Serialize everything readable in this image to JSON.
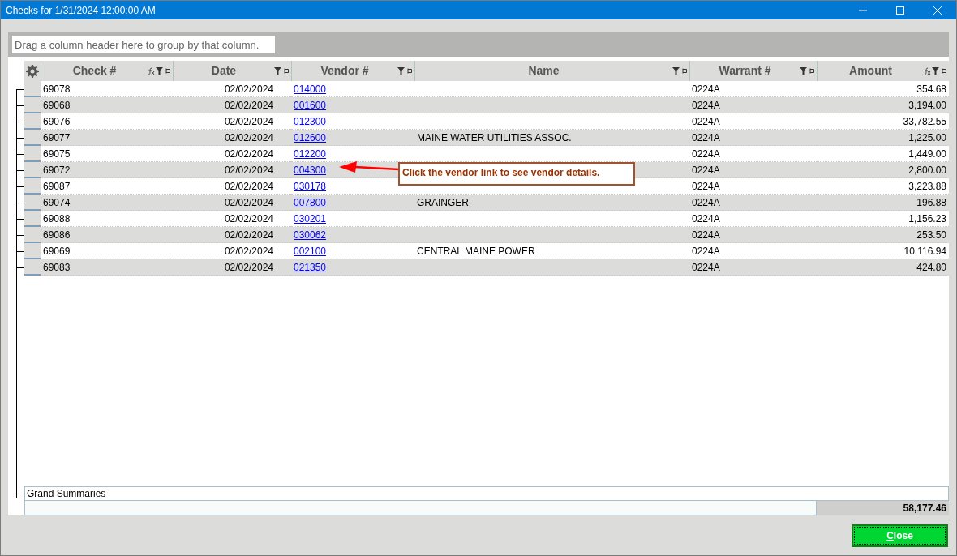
{
  "window": {
    "title": "Checks for 1/31/2024 12:00:00 AM"
  },
  "group_panel": {
    "placeholder": "Drag a column header here to group by that column."
  },
  "table": {
    "columns": [
      {
        "label": "Check #",
        "kind": "text",
        "fx": true
      },
      {
        "label": "Date",
        "kind": "text",
        "fx": false
      },
      {
        "label": "Vendor #",
        "kind": "link",
        "fx": false
      },
      {
        "label": "Name",
        "kind": "text",
        "fx": false
      },
      {
        "label": "Warrant #",
        "kind": "text",
        "fx": false
      },
      {
        "label": "Amount",
        "kind": "text",
        "fx": true
      }
    ],
    "rows": [
      [
        "69078",
        "02/02/2024",
        "014000",
        "",
        "0224A",
        "354.68"
      ],
      [
        "69068",
        "02/02/2024",
        "001600",
        "",
        "0224A",
        "3,194.00"
      ],
      [
        "69076",
        "02/02/2024",
        "012300",
        "",
        "0224A",
        "33,782.55"
      ],
      [
        "69077",
        "02/02/2024",
        "012600",
        "MAINE WATER UTILITIES ASSOC.",
        "0224A",
        "1,225.00"
      ],
      [
        "69075",
        "02/02/2024",
        "012200",
        "",
        "0224A",
        "1,449.00"
      ],
      [
        "69072",
        "02/02/2024",
        "004300",
        "",
        "0224A",
        "2,800.00"
      ],
      [
        "69087",
        "02/02/2024",
        "030178",
        "",
        "0224A",
        "3,223.88"
      ],
      [
        "69074",
        "02/02/2024",
        "007800",
        "GRAINGER",
        "0224A",
        "196.88"
      ],
      [
        "69088",
        "02/02/2024",
        "030201",
        "",
        "0224A",
        "1,156.23"
      ],
      [
        "69086",
        "02/02/2024",
        "030062",
        "",
        "0224A",
        "253.50"
      ],
      [
        "69069",
        "02/02/2024",
        "002100",
        "CENTRAL MAINE POWER",
        "0224A",
        "10,116.94"
      ],
      [
        "69083",
        "02/02/2024",
        "021350",
        "",
        "0224A",
        "424.80"
      ]
    ],
    "summary": {
      "label": "Grand Summaries",
      "total": "58,177.46"
    }
  },
  "callout": {
    "text": "Click the vendor link to see vendor details."
  },
  "buttons": [
    "Close"
  ]
}
